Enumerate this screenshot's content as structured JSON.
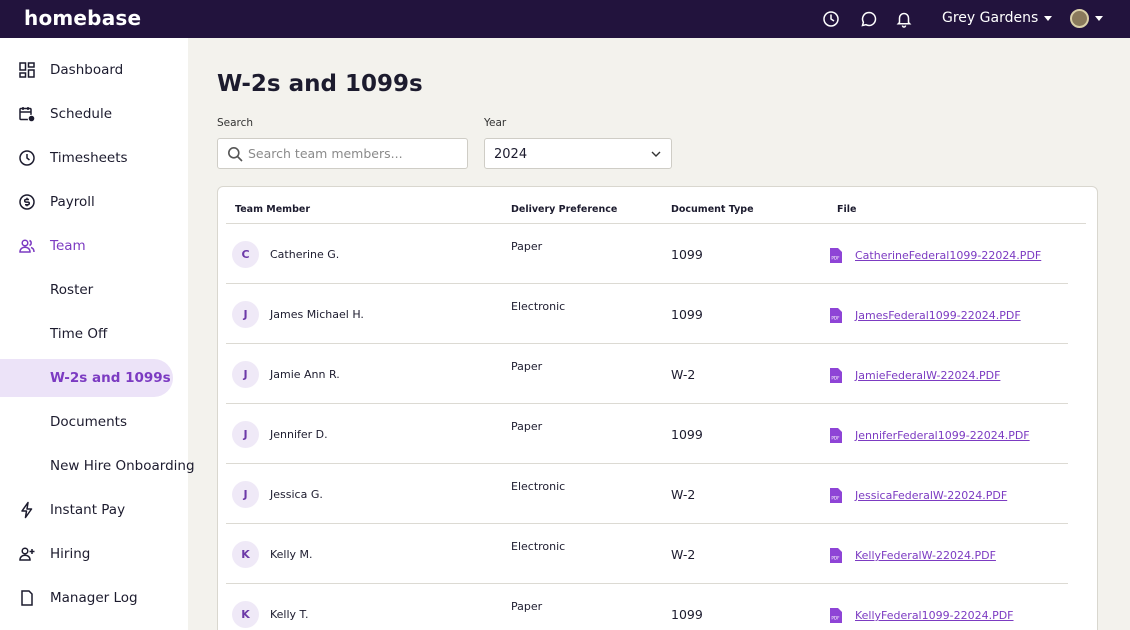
{
  "app": {
    "logo": "homebase",
    "location": "Grey Gardens"
  },
  "sidebar": {
    "items": [
      {
        "label": "Dashboard",
        "icon": "dashboard-icon"
      },
      {
        "label": "Schedule",
        "icon": "calendar-clock-icon"
      },
      {
        "label": "Timesheets",
        "icon": "clock-icon"
      },
      {
        "label": "Payroll",
        "icon": "dollar-circle-icon"
      },
      {
        "label": "Team",
        "icon": "team-icon",
        "active": true
      },
      {
        "label": "Roster"
      },
      {
        "label": "Time Off"
      },
      {
        "label": "W-2s and 1099s",
        "selected": true
      },
      {
        "label": "Documents"
      },
      {
        "label": "New Hire Onboarding"
      },
      {
        "label": "Instant Pay",
        "icon": "lightning-icon"
      },
      {
        "label": "Hiring",
        "icon": "add-user-icon"
      },
      {
        "label": "Manager Log",
        "icon": "document-icon"
      }
    ]
  },
  "main": {
    "title": "W-2s and 1099s",
    "search": {
      "label": "Search",
      "placeholder": "Search team members..."
    },
    "year": {
      "label": "Year",
      "value": "2024"
    },
    "table": {
      "headers": [
        "Team Member",
        "Delivery Preference",
        "Document Type",
        "File"
      ],
      "rows": [
        {
          "initial": "C",
          "name": "Catherine G.",
          "pref": "Paper",
          "type": "1099",
          "file": "CatherineFederal1099-22024.PDF"
        },
        {
          "initial": "J",
          "name": "James Michael H.",
          "pref": "Electronic",
          "type": "1099",
          "file": "JamesFederal1099-22024.PDF"
        },
        {
          "initial": "J",
          "name": "Jamie Ann R.",
          "pref": "Paper",
          "type": "W-2",
          "file": "JamieFederalW-22024.PDF"
        },
        {
          "initial": "J",
          "name": "Jennifer D.",
          "pref": "Paper",
          "type": "1099",
          "file": "JenniferFederal1099-22024.PDF"
        },
        {
          "initial": "J",
          "name": "Jessica G.",
          "pref": "Electronic",
          "type": "W-2",
          "file": "JessicaFederalW-22024.PDF"
        },
        {
          "initial": "K",
          "name": "Kelly M.",
          "pref": "Electronic",
          "type": "W-2",
          "file": "KellyFederalW-22024.PDF"
        },
        {
          "initial": "K",
          "name": "Kelly T.",
          "pref": "Paper",
          "type": "1099",
          "file": "KellyFederal1099-22024.PDF"
        }
      ]
    }
  },
  "colors": {
    "topbar": "#22133d",
    "accent": "#7c3bc2",
    "selected_bg": "#ece3f8",
    "page_bg": "#f3f2ed"
  }
}
